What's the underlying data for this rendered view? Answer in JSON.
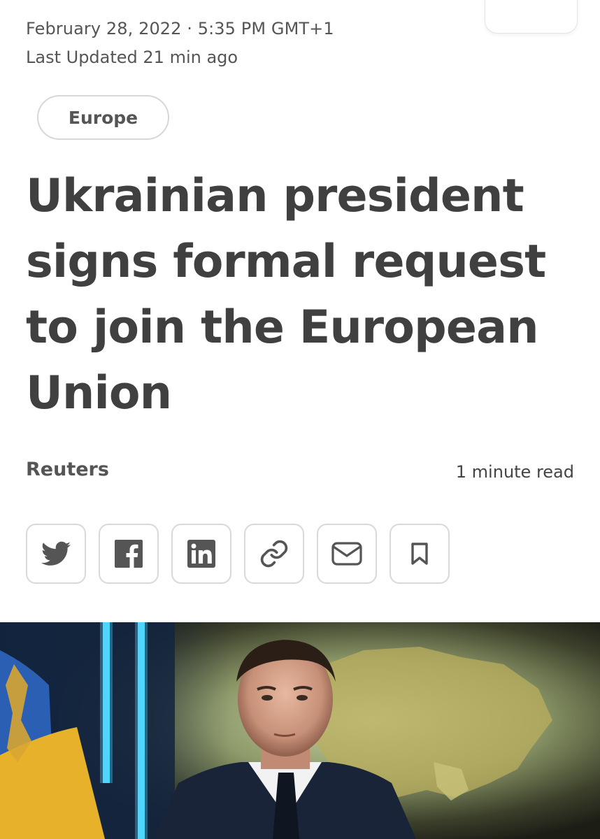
{
  "meta": {
    "dateline": "February 28, 2022 · 5:35 PM GMT+1",
    "last_updated": "Last Updated 21 min ago"
  },
  "category": "Europe",
  "headline": "Ukrainian president signs formal request to join the European Union",
  "byline": "Reuters",
  "read_time": "1 minute read",
  "share_buttons": [
    {
      "icon": "twitter-icon"
    },
    {
      "icon": "facebook-icon"
    },
    {
      "icon": "linkedin-icon"
    },
    {
      "icon": "link-icon"
    },
    {
      "icon": "mail-icon"
    },
    {
      "icon": "bookmark-icon"
    }
  ],
  "colors": {
    "text": "#404040",
    "muted": "#555555",
    "border": "#d9d9d9"
  }
}
